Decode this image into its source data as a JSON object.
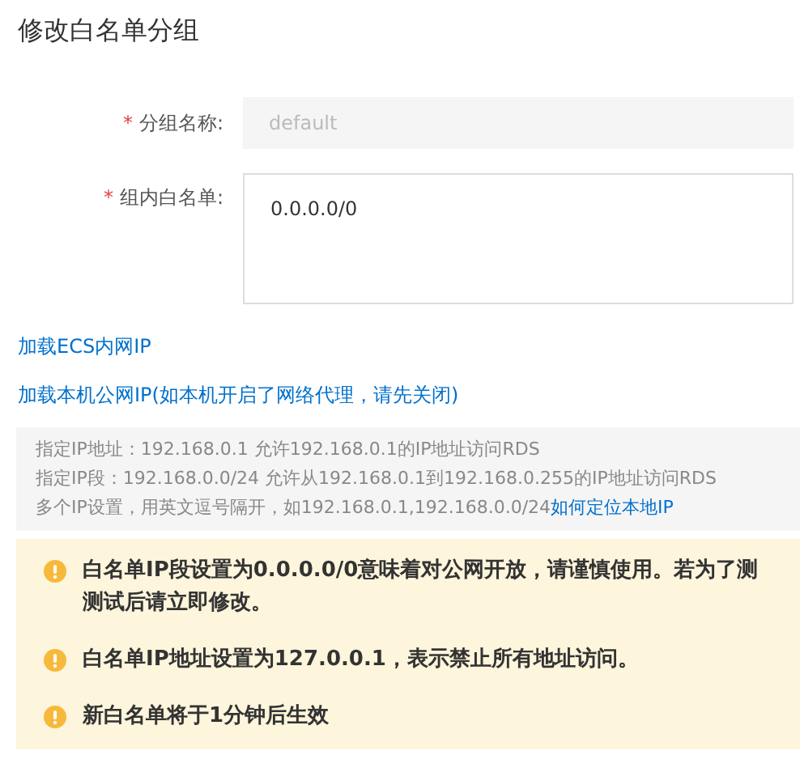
{
  "title": "修改白名单分组",
  "fields": [
    {
      "kind": "input",
      "required_mark": "*",
      "label": "分组名称:",
      "value": "default",
      "disabled": true
    },
    {
      "kind": "textarea",
      "required_mark": "*",
      "label": "组内白名单:",
      "value": "0.0.0.0/0",
      "disabled": false
    }
  ],
  "links": [
    "加载ECS内网IP",
    "加载本机公网IP(如本机开启了网络代理，请先关闭)"
  ],
  "hints": [
    {
      "text": "指定IP地址：192.168.0.1 允许192.168.0.1的IP地址访问RDS"
    },
    {
      "text": "指定IP段：192.168.0.0/24 允许从192.168.0.1到192.168.0.255的IP地址访问RDS"
    },
    {
      "text": "多个IP设置，用英文逗号隔开，如192.168.0.1,192.168.0.0/24",
      "link": "如何定位本地IP"
    }
  ],
  "warnings": [
    {
      "lines": [
        "白名单IP段设置为0.0.0.0/0意味着对公网开放，请谨慎使用。若为了测",
        "测试后请立即修改。"
      ]
    },
    {
      "lines": [
        "白名单IP地址设置为127.0.0.1，表示禁止所有地址访问。"
      ]
    },
    {
      "lines": [
        "新白名单将于1分钟后生效"
      ]
    }
  ]
}
